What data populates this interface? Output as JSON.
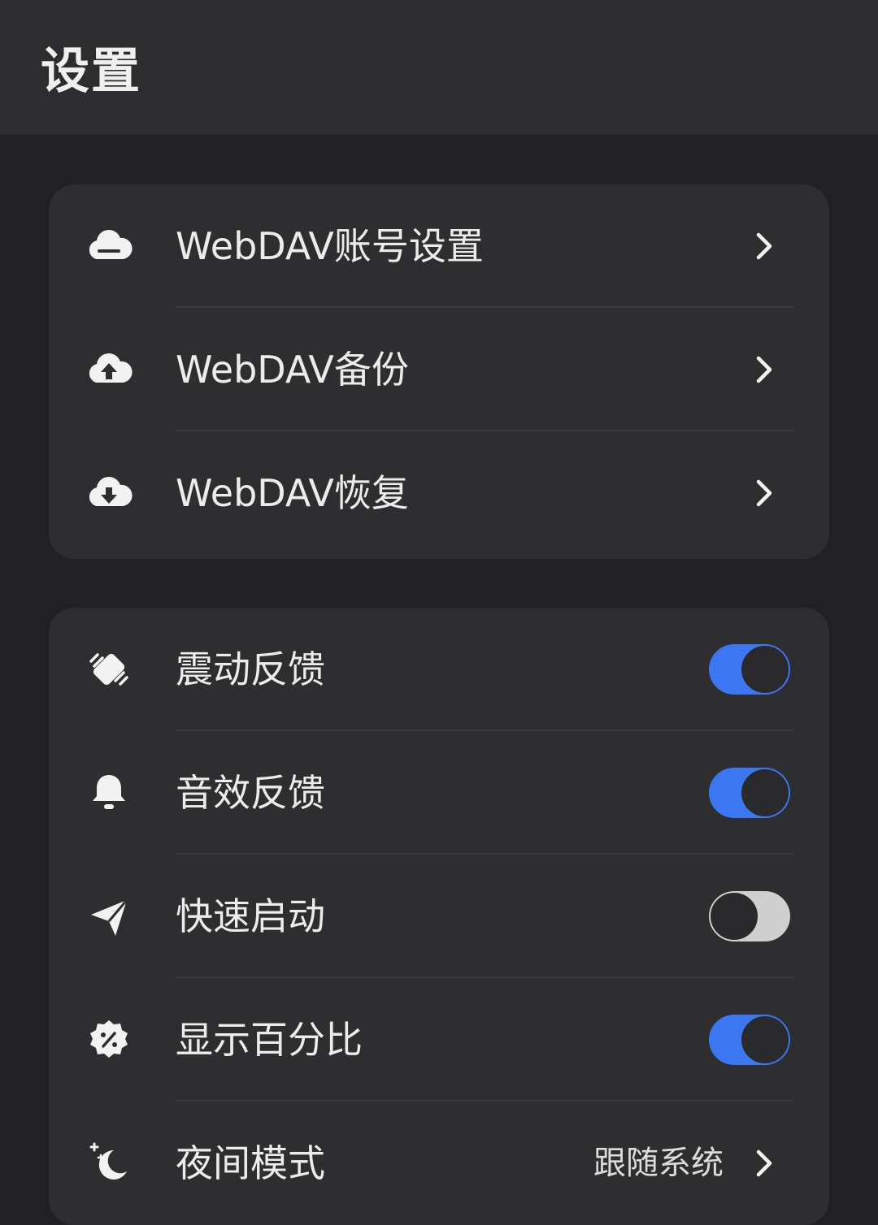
{
  "header": {
    "title": "设置"
  },
  "colors": {
    "accent": "#3b77f3",
    "card": "#2e2e30",
    "background": "#212123"
  },
  "webdav_group": {
    "items": [
      {
        "label": "WebDAV账号设置",
        "icon": "cloud-account-icon"
      },
      {
        "label": "WebDAV备份",
        "icon": "cloud-upload-icon"
      },
      {
        "label": "WebDAV恢复",
        "icon": "cloud-download-icon"
      }
    ]
  },
  "prefs_group": {
    "items": [
      {
        "label": "震动反馈",
        "icon": "vibration-icon",
        "toggle": true
      },
      {
        "label": "音效反馈",
        "icon": "bell-icon",
        "toggle": true
      },
      {
        "label": "快速启动",
        "icon": "send-icon",
        "toggle": false
      },
      {
        "label": "显示百分比",
        "icon": "percent-badge-icon",
        "toggle": true
      },
      {
        "label": "夜间模式",
        "icon": "moon-icon",
        "value": "跟随系统"
      }
    ]
  }
}
